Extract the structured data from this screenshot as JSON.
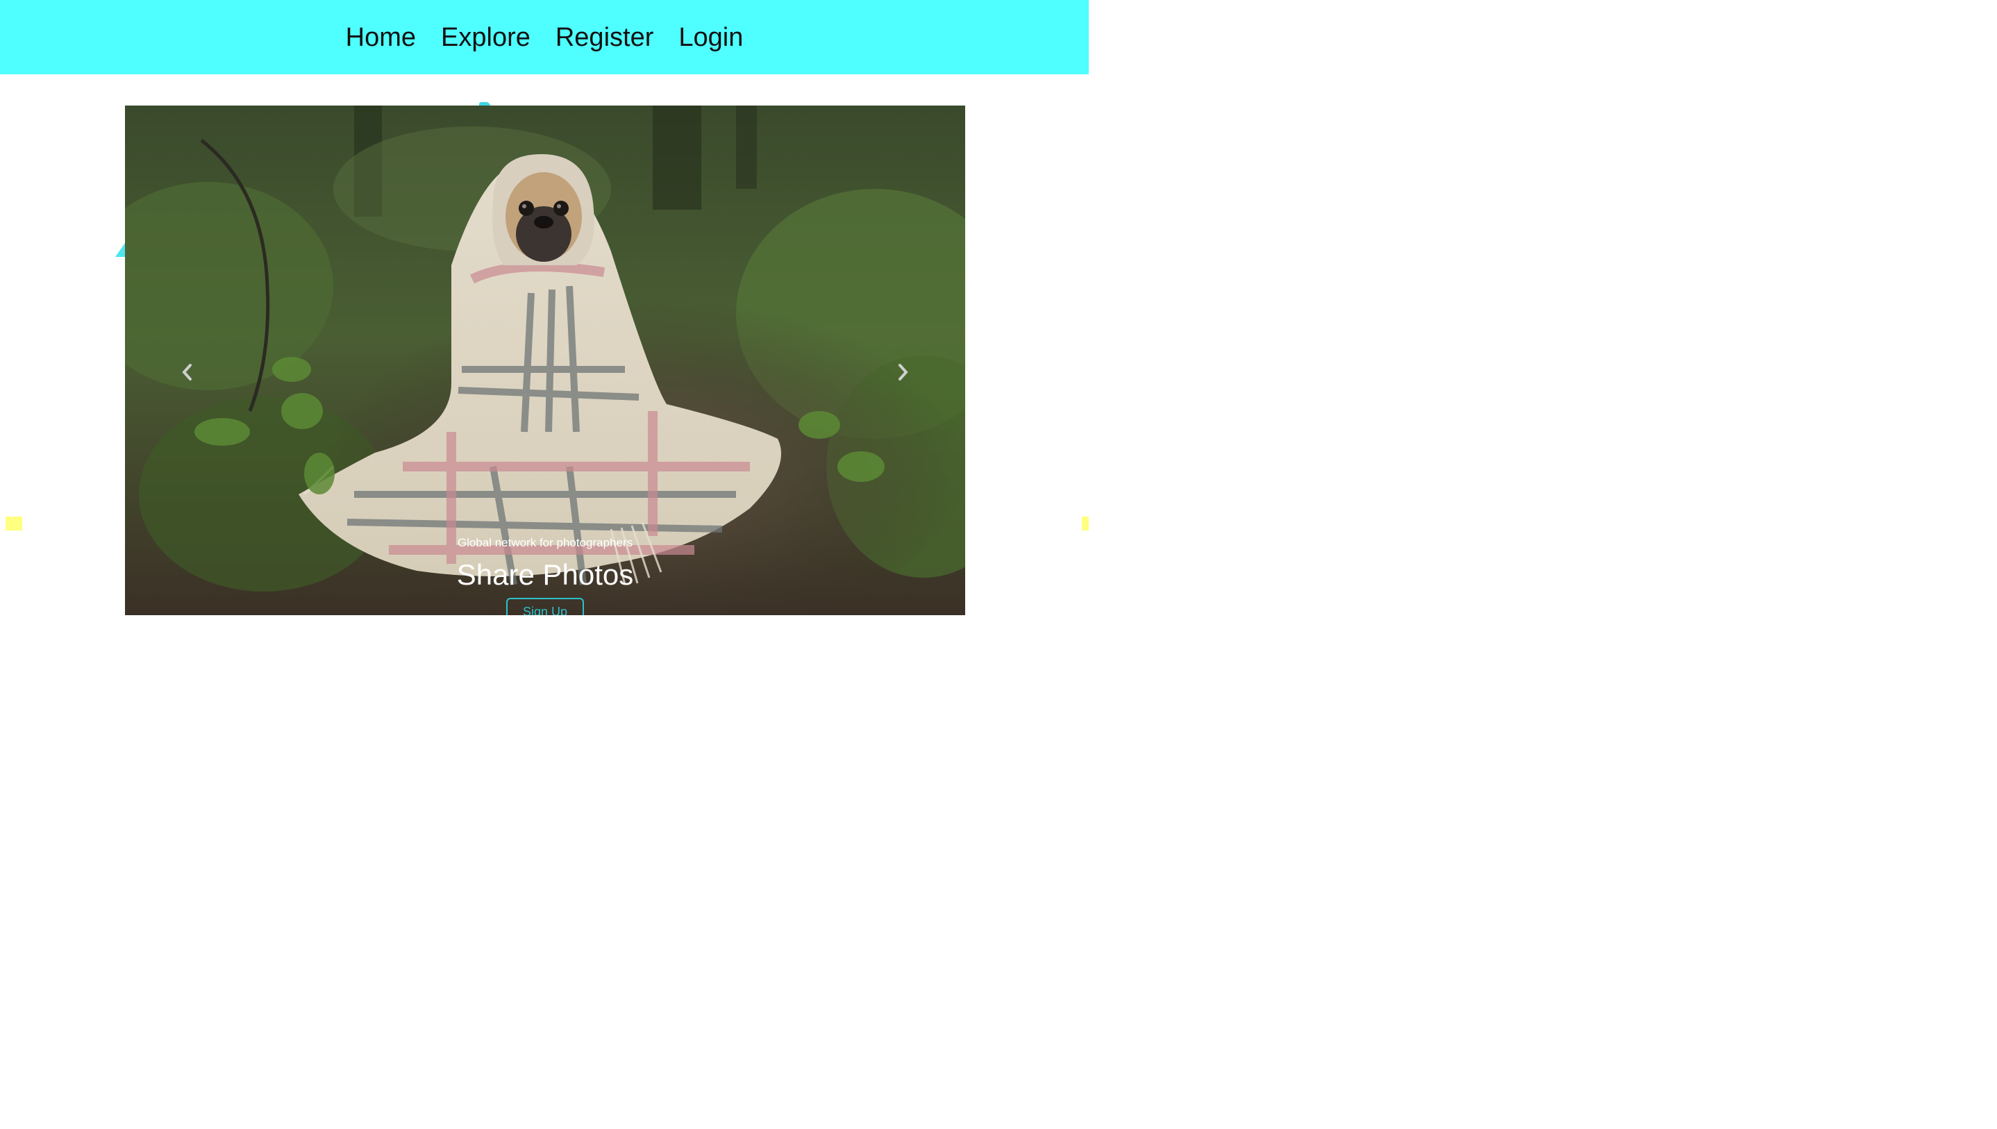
{
  "nav": {
    "items": [
      {
        "label": "Home"
      },
      {
        "label": "Explore"
      },
      {
        "label": "Register"
      },
      {
        "label": "Login"
      }
    ]
  },
  "hero": {
    "subtitle": "Global network for photographers",
    "title": "Share Photos",
    "cta_label": "Sign Up",
    "prev_icon": "chevron-left-icon",
    "next_icon": "chevron-right-icon"
  },
  "colors": {
    "navbar_bg": "#4ffeff",
    "accent": "#2bc1c9",
    "decor_yellow": "#ffff80"
  }
}
